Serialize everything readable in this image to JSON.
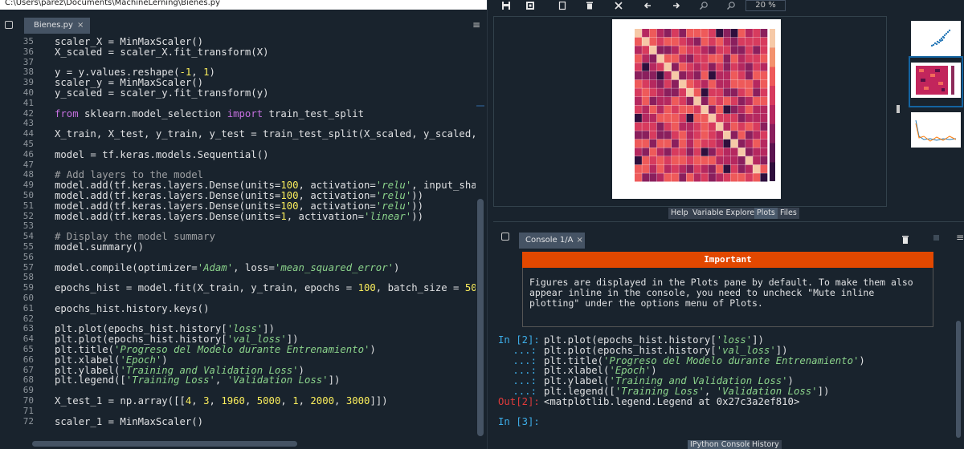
{
  "window": {
    "path": "C:\\Users\\parez\\Documents\\MachineLerning\\Bienes.py"
  },
  "editor": {
    "tab_label": "Bienes.py",
    "tab_close": "×",
    "menu_icon": "≡",
    "line_numbers": [
      "35",
      "36",
      "37",
      "38",
      "39",
      "40",
      "41",
      "42",
      "43",
      "44",
      "45",
      "46",
      "47",
      "48",
      "49",
      "50",
      "51",
      "52",
      "53",
      "54",
      "55",
      "56",
      "57",
      "58",
      "59",
      "60",
      "61",
      "62",
      "63",
      "64",
      "65",
      "66",
      "67",
      "68",
      "69",
      "70",
      "71",
      "72"
    ],
    "lines": [
      [
        [
          "scaler_X = MinMaxScaler()",
          ""
        ]
      ],
      [
        [
          "X_scaled = scaler_X.fit_transform(X)",
          ""
        ]
      ],
      [],
      [
        [
          "y = y.values.reshape(",
          ""
        ],
        [
          "-1",
          "num"
        ],
        [
          ", ",
          ""
        ],
        [
          "1",
          "num"
        ],
        [
          ")",
          ""
        ]
      ],
      [
        [
          "scaler_y = MinMaxScaler()",
          ""
        ]
      ],
      [
        [
          "y_scaled = scaler_y.fit_transform(y)",
          ""
        ]
      ],
      [],
      [
        [
          "from",
          "kw"
        ],
        [
          " sklearn.model_selection ",
          ""
        ],
        [
          "import",
          "kw"
        ],
        [
          " train_test_split",
          ""
        ]
      ],
      [],
      [
        [
          "X_train, X_test, y_train, y_test = train_test_split(X_scaled, y_scaled,",
          ""
        ]
      ],
      [],
      [
        [
          "model = tf.keras.models.Sequential()",
          ""
        ]
      ],
      [],
      [
        [
          "# Add layers to the model",
          "cm"
        ]
      ],
      [
        [
          "model.add(tf.keras.layers.Dense(units=",
          ""
        ],
        [
          "100",
          "num"
        ],
        [
          ", activation=",
          ""
        ],
        [
          "'relu'",
          "str"
        ],
        [
          ", input_shap",
          ""
        ]
      ],
      [
        [
          "model.add(tf.keras.layers.Dense(units=",
          ""
        ],
        [
          "100",
          "num"
        ],
        [
          ", activation=",
          ""
        ],
        [
          "'relu'",
          "str"
        ],
        [
          "))",
          ""
        ]
      ],
      [
        [
          "model.add(tf.keras.layers.Dense(units=",
          ""
        ],
        [
          "100",
          "num"
        ],
        [
          ", activation=",
          ""
        ],
        [
          "'relu'",
          "str"
        ],
        [
          "))",
          ""
        ]
      ],
      [
        [
          "model.add(tf.keras.layers.Dense(units=",
          ""
        ],
        [
          "1",
          "num"
        ],
        [
          ", activation=",
          ""
        ],
        [
          "'linear'",
          "str"
        ],
        [
          "))",
          ""
        ]
      ],
      [],
      [
        [
          "# Display the model summary",
          "cm"
        ]
      ],
      [
        [
          "model.summary()",
          ""
        ]
      ],
      [],
      [
        [
          "model.compile(optimizer=",
          ""
        ],
        [
          "'Adam'",
          "str"
        ],
        [
          ", loss=",
          ""
        ],
        [
          "'mean_squared_error'",
          "str"
        ],
        [
          ")",
          ""
        ]
      ],
      [],
      [
        [
          "epochs_hist = model.fit(X_train, y_train, epochs = ",
          ""
        ],
        [
          "100",
          "num"
        ],
        [
          ", batch_size = ",
          ""
        ],
        [
          "50",
          "num"
        ],
        [
          ",",
          ""
        ]
      ],
      [],
      [
        [
          "epochs_hist.history.keys()",
          ""
        ]
      ],
      [],
      [
        [
          "plt.plot(epochs_hist.history[",
          ""
        ],
        [
          "'loss'",
          "str"
        ],
        [
          "])",
          ""
        ]
      ],
      [
        [
          "plt.plot(epochs_hist.history[",
          ""
        ],
        [
          "'val_loss'",
          "str"
        ],
        [
          "])",
          ""
        ]
      ],
      [
        [
          "plt.title(",
          ""
        ],
        [
          "'Progreso del Modelo durante Entrenamiento'",
          "str"
        ],
        [
          ")",
          ""
        ]
      ],
      [
        [
          "plt.xlabel(",
          ""
        ],
        [
          "'Epoch'",
          "str"
        ],
        [
          ")",
          ""
        ]
      ],
      [
        [
          "plt.ylabel(",
          ""
        ],
        [
          "'Training and Validation Loss'",
          "str"
        ],
        [
          ")",
          ""
        ]
      ],
      [
        [
          "plt.legend([",
          ""
        ],
        [
          "'Training Loss'",
          "str"
        ],
        [
          ", ",
          ""
        ],
        [
          "'Validation Loss'",
          "str"
        ],
        [
          "])",
          ""
        ]
      ],
      [],
      [
        [
          "X_test_1 = np.array([[",
          ""
        ],
        [
          "4",
          "num"
        ],
        [
          ", ",
          ""
        ],
        [
          "3",
          "num"
        ],
        [
          ", ",
          ""
        ],
        [
          "1960",
          "num"
        ],
        [
          ", ",
          ""
        ],
        [
          "5000",
          "num"
        ],
        [
          ", ",
          ""
        ],
        [
          "1",
          "num"
        ],
        [
          ", ",
          ""
        ],
        [
          "2000",
          "num"
        ],
        [
          ", ",
          ""
        ],
        [
          "3000",
          "num"
        ],
        [
          "]])",
          ""
        ]
      ],
      [],
      [
        [
          "scaler_1 = MinMaxScaler()",
          ""
        ]
      ]
    ]
  },
  "plots": {
    "zoom": "20 %",
    "toolbar_icons": [
      "save-icon",
      "save-all-icon",
      "copy-icon",
      "delete-icon",
      "close-all-icon",
      "prev-arrow-icon",
      "next-arrow-icon",
      "zoom-in-icon",
      "zoom-out-icon"
    ],
    "pane_tabs": [
      "Help",
      "Variable Explorer",
      "Plots",
      "Files"
    ],
    "active_pane_tab": "Plots"
  },
  "console": {
    "tab_label": "Console 1/A",
    "tab_close": "×",
    "menu_icon": "≡",
    "important_title": "Important",
    "important_lines": [
      "Figures are displayed in the Plots pane by default. To make them also",
      "appear inline in the console, you need to uncheck \"Mute inline",
      "plotting\" under the options menu of Plots."
    ],
    "prompts": [
      {
        "prompt": "In [2]:",
        "type": "in",
        "segs": [
          [
            "plt.plot(epochs_hist.history[",
            ""
          ],
          [
            "'loss'",
            "str"
          ],
          [
            "])",
            ""
          ]
        ]
      },
      {
        "prompt": "...:",
        "type": "in",
        "segs": [
          [
            "plt.plot(epochs_hist.history[",
            ""
          ],
          [
            "'val_loss'",
            "str"
          ],
          [
            "])",
            ""
          ]
        ]
      },
      {
        "prompt": "...:",
        "type": "in",
        "segs": [
          [
            "plt.title(",
            ""
          ],
          [
            "'Progreso del Modelo durante Entrenamiento'",
            "str"
          ],
          [
            ")",
            ""
          ]
        ]
      },
      {
        "prompt": "...:",
        "type": "in",
        "segs": [
          [
            "plt.xlabel(",
            ""
          ],
          [
            "'Epoch'",
            "str"
          ],
          [
            ")",
            ""
          ]
        ]
      },
      {
        "prompt": "...:",
        "type": "in",
        "segs": [
          [
            "plt.ylabel(",
            ""
          ],
          [
            "'Training and Validation Loss'",
            "str"
          ],
          [
            ")",
            ""
          ]
        ]
      },
      {
        "prompt": "...:",
        "type": "in",
        "segs": [
          [
            "plt.legend([",
            ""
          ],
          [
            "'Training Loss'",
            "str"
          ],
          [
            ", ",
            ""
          ],
          [
            "'Validation Loss'",
            "str"
          ],
          [
            "])",
            ""
          ]
        ]
      },
      {
        "prompt": "Out[2]:",
        "type": "out",
        "segs": [
          [
            "<matplotlib.legend.Legend at 0x27c3a2ef810>",
            ""
          ]
        ]
      },
      {
        "prompt": "",
        "type": "blank",
        "segs": []
      },
      {
        "prompt": "In [3]:",
        "type": "in",
        "segs": []
      }
    ],
    "bottom_tabs": [
      "IPython Console",
      "History"
    ],
    "active_bottom_tab": "IPython Console"
  },
  "colors": {
    "background": "#19232d",
    "tab": "#455364",
    "important_header": "#e24800",
    "prompt_in": "#3daee9",
    "prompt_out": "#e03b3b",
    "string": "#8bd38b",
    "keyword": "#c670e0",
    "number": "#faed5c"
  }
}
